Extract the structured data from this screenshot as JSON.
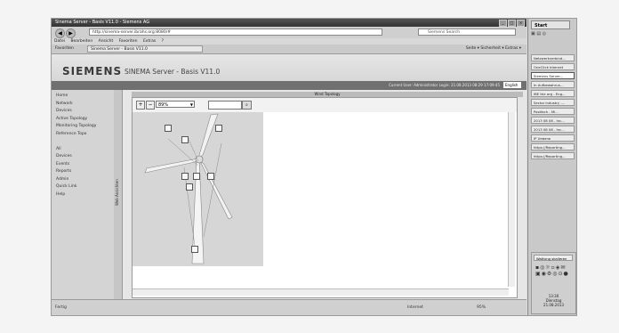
{
  "browser": {
    "window_title": "Sinema Server - Basis V11.0 - Siemens AG",
    "address": "http://sinema-server.ibrahs.org:8080/#",
    "search_placeholder": "Siemens Search",
    "menu": [
      "Datei",
      "Bearbeiten",
      "Ansicht",
      "Favoriten",
      "Extras",
      "?"
    ],
    "favorites_label": "Favoriten",
    "tab_label": "Sinema Server - Basis V11.0",
    "tools_text": "Seite ▾  Sicherheit ▾  Extras ▾"
  },
  "header": {
    "logo": "SIEMENS",
    "title": "SINEMA Server - Basis V11.0"
  },
  "status_bar": {
    "text": "Current User: Administrator   Login: 21.08.2013 08:29 17:09:45",
    "language": "English"
  },
  "sidebar": {
    "items": [
      "Home",
      "Network",
      "Devices",
      "Active Topology",
      "Monitoring Topology",
      "Reference Topo",
      "",
      "All",
      "Devices",
      "Events",
      "Reports",
      "Admin",
      "Quick Link",
      "Help"
    ]
  },
  "vertical_tab": {
    "label": "Web Ansichten"
  },
  "view": {
    "title": "Wind Topology",
    "zoom": "89%"
  },
  "footer": {
    "status": "Fertig",
    "zone": "Internet",
    "zoom": "95%"
  },
  "taskbar": {
    "start": "Start",
    "items": [
      "Netzwerkverbind...",
      "OneClick Internet",
      "Siemens Server...",
      "In Aufbewahrun...",
      "IBE the org - Eng...",
      "Sector Industry -...",
      "Postfach - Mi...",
      "2013 08 08 - Inc...",
      "2013 08 08 - Inc...",
      "IP Ueberw",
      "https://Reporting...",
      "https://Reporting..."
    ],
    "active_index": 2,
    "tray_label": "Wattung skalieren",
    "time": "13:30",
    "day": "Dienstag",
    "date": "21.08.2013"
  }
}
